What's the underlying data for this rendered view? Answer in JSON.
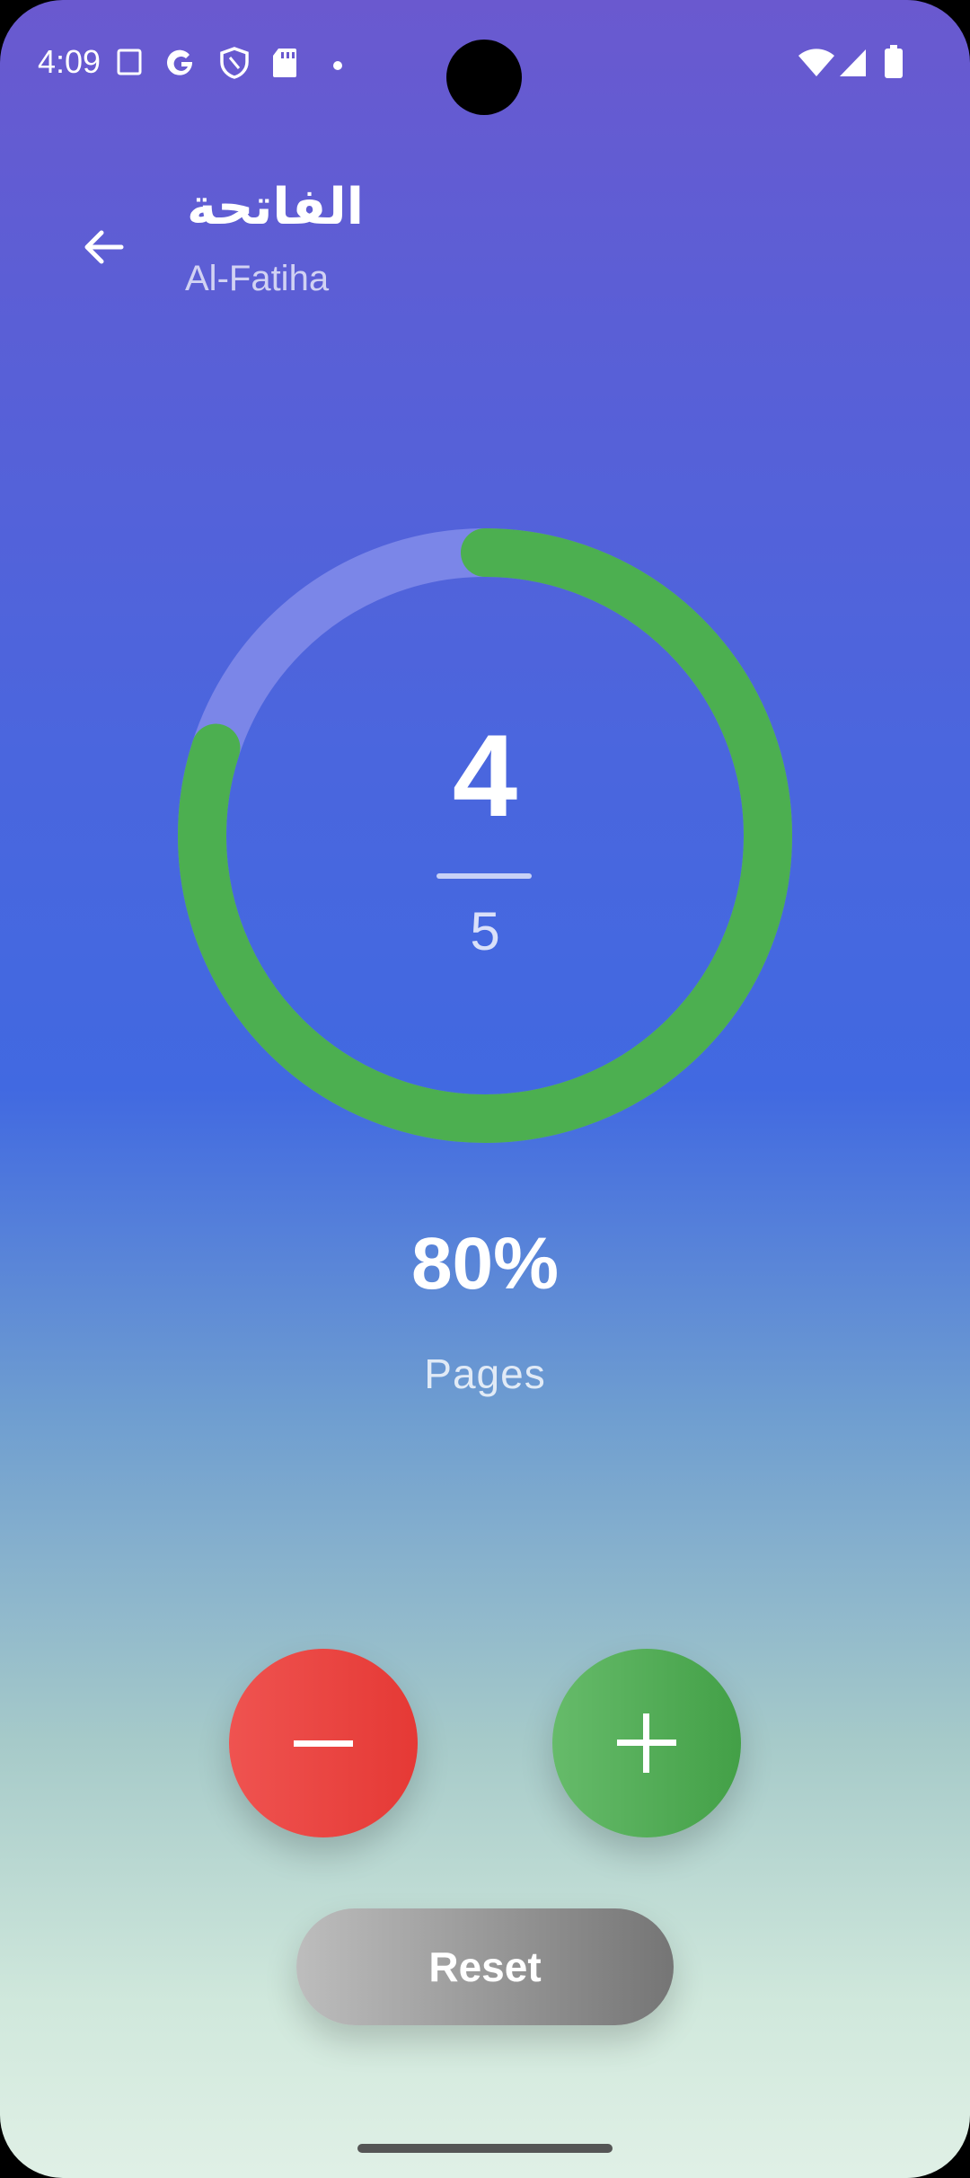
{
  "status_bar": {
    "time": "4:09",
    "left_icons": [
      "screenshot-icon",
      "google-icon",
      "shield-icon",
      "sd-card-icon",
      "dot-icon"
    ],
    "right_icons": [
      "wifi-icon",
      "signal-icon",
      "battery-icon"
    ]
  },
  "header": {
    "title_arabic": "الفاتحة",
    "title_english": "Al-Fatiha",
    "back_icon": "arrow-left-icon"
  },
  "progress": {
    "current": "4",
    "total": "5",
    "fraction": 0.8,
    "percent_label": "80%",
    "unit_label": "Pages",
    "track_color": "#7b86e8",
    "progress_color": "#4caf50"
  },
  "controls": {
    "decrement_icon": "minus-icon",
    "increment_icon": "plus-icon",
    "decrement_color": "#e53935",
    "increment_color": "#43a047",
    "reset_label": "Reset"
  }
}
